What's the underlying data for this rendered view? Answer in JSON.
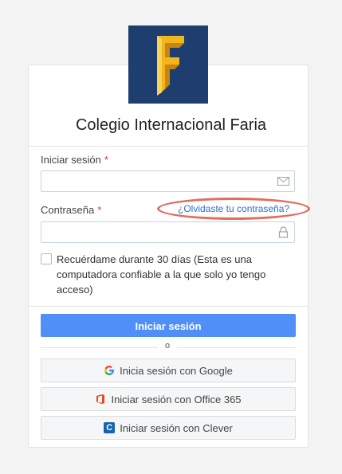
{
  "school": {
    "name": "Colegio Internacional Faria",
    "logo_letter": "F"
  },
  "form": {
    "username_label": "Iniciar sesión",
    "password_label": "Contraseña",
    "required_mark": "*",
    "forgot_password_link": "¿Olvidaste tu contraseña?",
    "remember_me": "Recuérdame durante 30 días (Esta es una computadora confiable a la que solo yo tengo acceso)",
    "username_value": "",
    "password_value": ""
  },
  "actions": {
    "login_button": "Iniciar sesión",
    "or_separator": "o",
    "google_button": "Inicia sesión con Google",
    "office_button": "Iniciar sesión con Office 365",
    "clever_button": "Iniciar sesión con Clever",
    "clever_icon_letter": "C"
  },
  "colors": {
    "primary": "#4f8ff7",
    "link": "#2e6fd1",
    "highlight": "#e46b5f",
    "logo_bg": "#1d3e6e",
    "logo_gold": "#f2b51c"
  },
  "icons": {
    "email_field": "envelope-icon",
    "password_field": "lock-icon",
    "google": "google-icon",
    "office": "office-365-icon",
    "clever": "clever-icon"
  }
}
